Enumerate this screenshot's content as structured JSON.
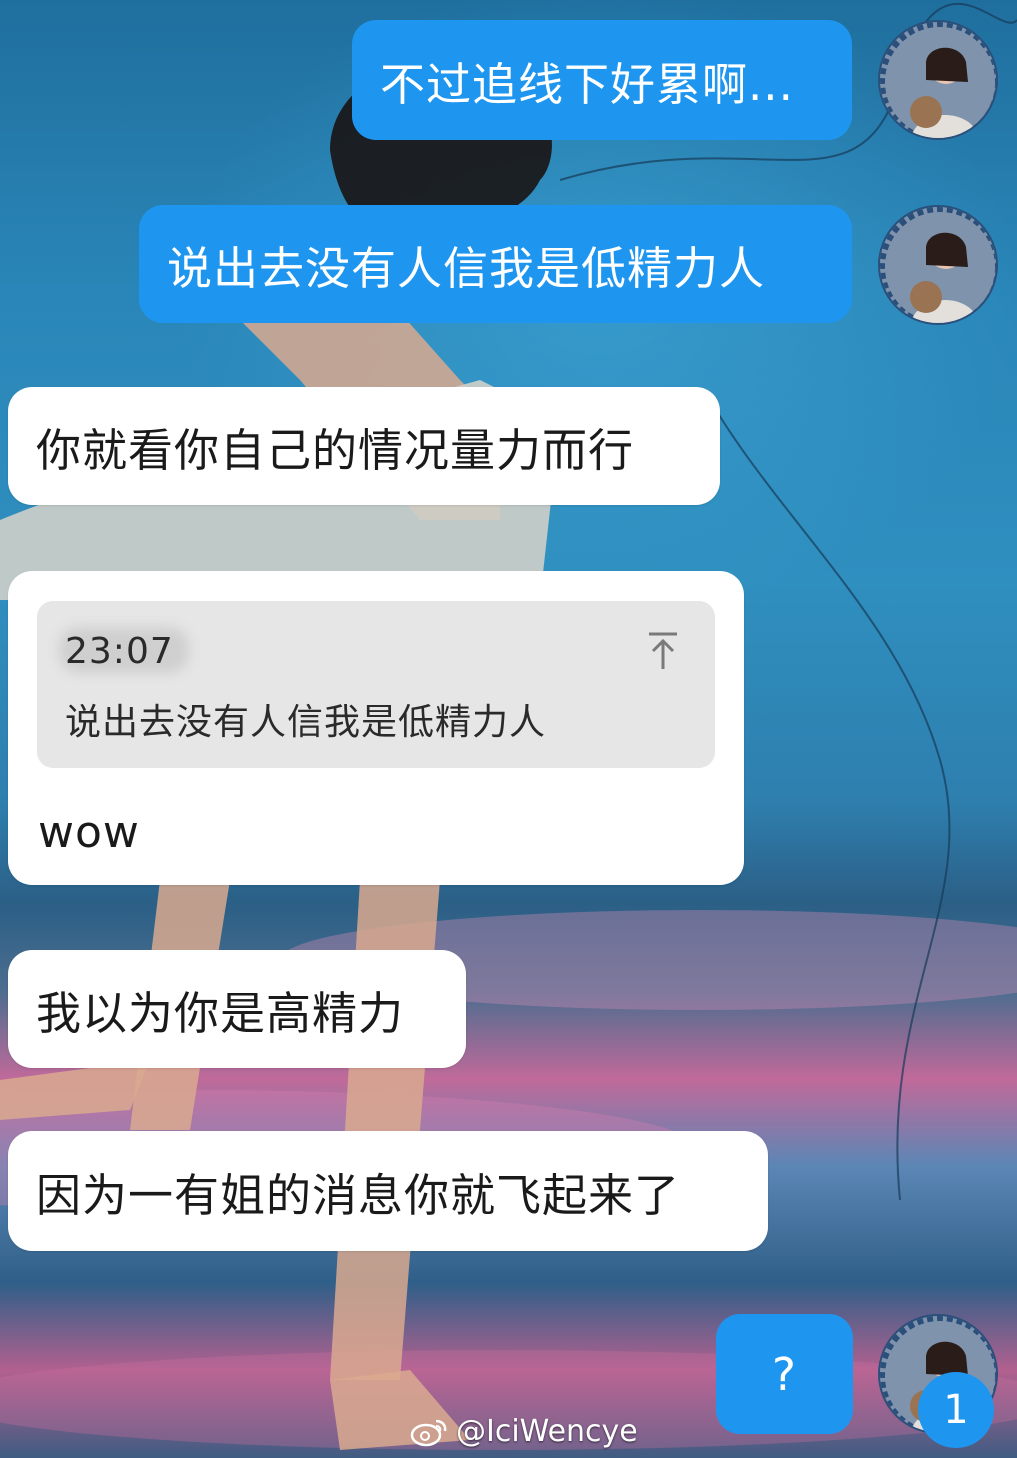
{
  "messages": [
    {
      "id": "m1",
      "side": "out",
      "text": "不过追线下好累啊..."
    },
    {
      "id": "m2",
      "side": "out",
      "text": "说出去没有人信我是低精力人"
    },
    {
      "id": "m3",
      "side": "in",
      "text": "你就看你自己的情况量力而行"
    },
    {
      "id": "m4",
      "side": "in",
      "quote": {
        "time": "23:07",
        "text": "说出去没有人信我是低精力人"
      },
      "text": "wow"
    },
    {
      "id": "m5",
      "side": "in",
      "text": "我以为你是高精力"
    },
    {
      "id": "m6",
      "side": "in",
      "text": "因为一有姐的消息你就飞起来了"
    },
    {
      "id": "m7",
      "side": "out",
      "text": "?"
    }
  ],
  "unread_badge": "1",
  "watermark": "@IciWencye",
  "colors": {
    "outgoing_bubble": "#1e96f0",
    "incoming_bubble": "#ffffff",
    "quote_card": "#e6e6e6"
  },
  "icons": [
    "avatar-user",
    "jump-to-quote-icon",
    "weibo-logo-icon"
  ]
}
